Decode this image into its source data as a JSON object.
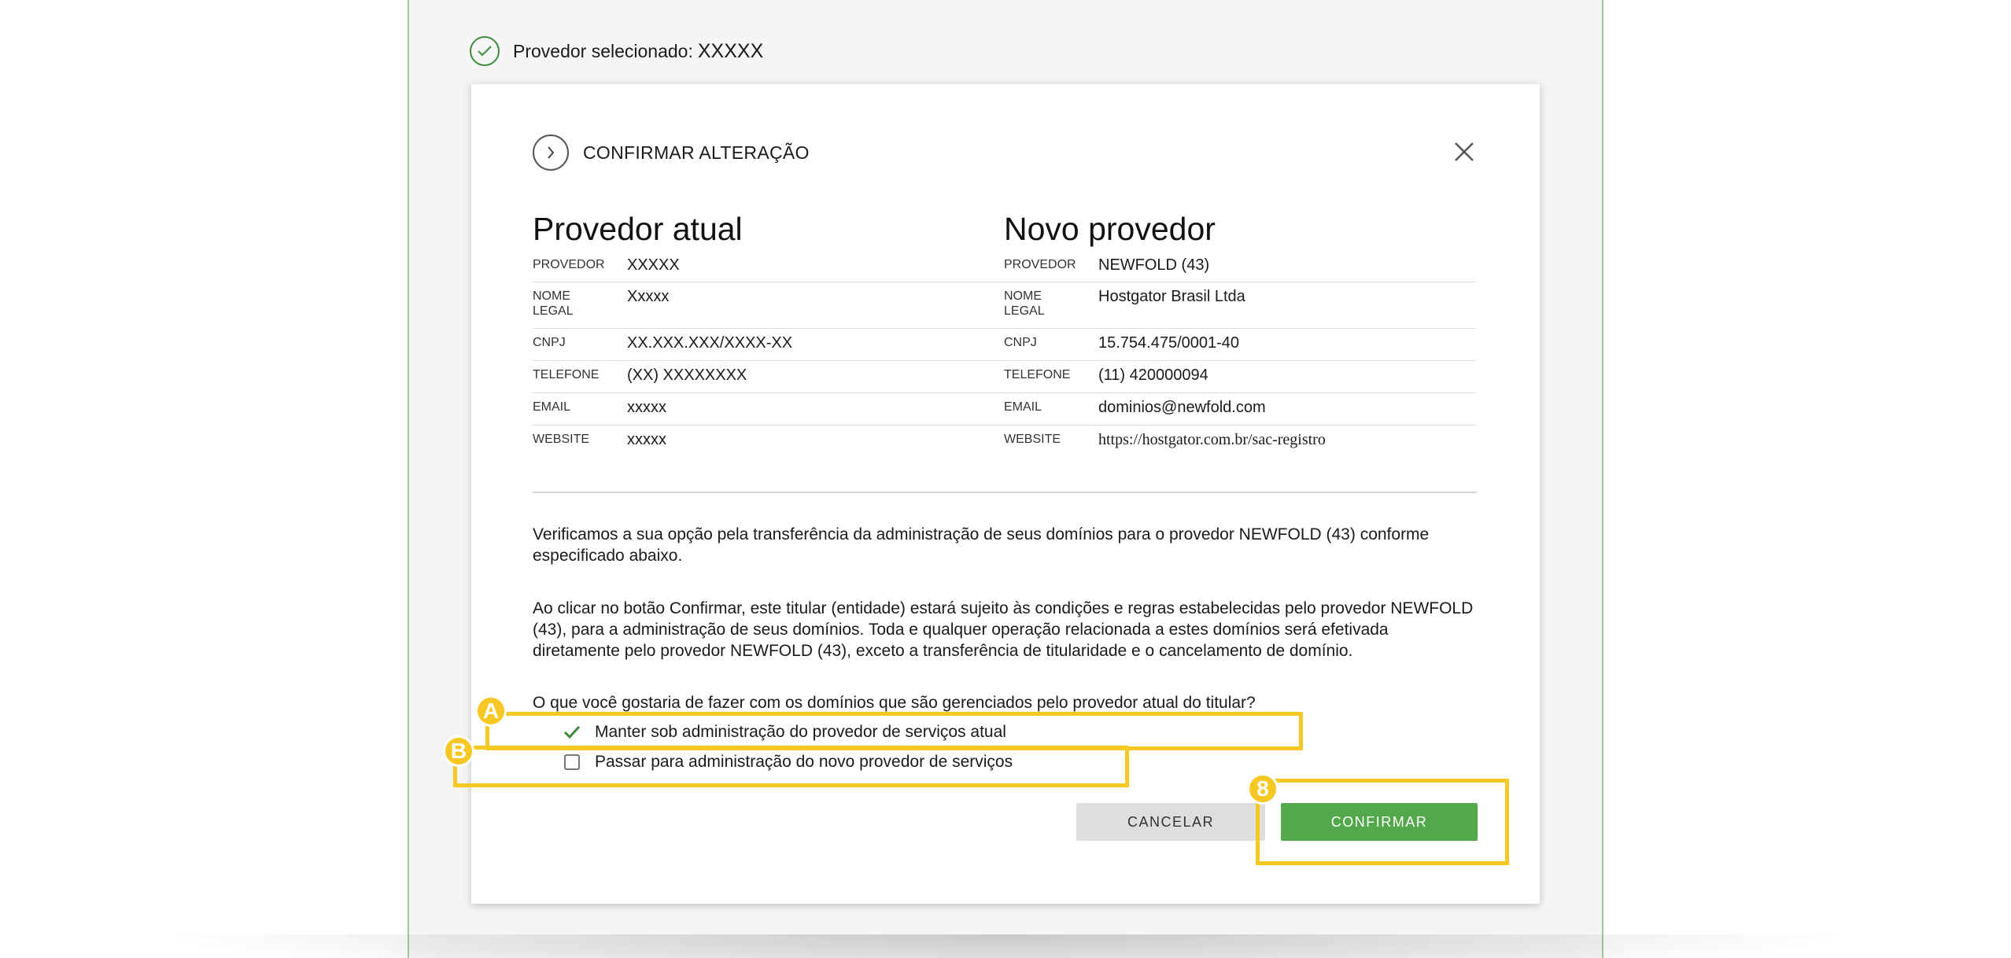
{
  "selected_provider": {
    "label": "Provedor selecionado:",
    "value": "XXXXX"
  },
  "modal": {
    "title": "CONFIRMAR ALTERAÇÃO",
    "current": {
      "heading": "Provedor atual",
      "rows": [
        {
          "label": "PROVEDOR",
          "value": "XXXXX"
        },
        {
          "label": "NOME\nLEGAL",
          "value": "Xxxxx"
        },
        {
          "label": "CNPJ",
          "value": "XX.XXX.XXX/XXXX-XX"
        },
        {
          "label": "TELEFONE",
          "value": "(XX) XXXXXXXX"
        },
        {
          "label": "EMAIL",
          "value": "xxxxx"
        },
        {
          "label": "WEBSITE",
          "value": "xxxxx"
        }
      ]
    },
    "new": {
      "heading": "Novo provedor",
      "rows": [
        {
          "label": "PROVEDOR",
          "value": "NEWFOLD (43)"
        },
        {
          "label": "NOME\nLEGAL",
          "value": "Hostgator Brasil Ltda"
        },
        {
          "label": "CNPJ",
          "value": "15.754.475/0001-40"
        },
        {
          "label": "TELEFONE",
          "value": "(11) 420000094"
        },
        {
          "label": "EMAIL",
          "value": "dominios@newfold.com"
        },
        {
          "label": "WEBSITE",
          "value": "https://hostgator.com.br/sac-registro"
        }
      ]
    },
    "paragraph1": "Verificamos a sua opção pela transferência da administração de seus domínios para o provedor NEWFOLD (43) conforme especificado abaixo.",
    "paragraph2": "Ao clicar no botão Confirmar, este titular (entidade) estará sujeito às condições e regras estabelecidas pelo provedor NEWFOLD (43), para a administração de seus domínios. Toda e qualquer operação relacionada a estes domínios será efetivada diretamente pelo provedor NEWFOLD (43), exceto a transferência de titularidade e o cancelamento de domínio.",
    "question": "O que você gostaria de fazer com os domínios que são gerenciados pelo provedor atual do titular?",
    "options": [
      {
        "label": "Manter sob administração do provedor de serviços atual",
        "checked": true
      },
      {
        "label": "Passar para administração do novo provedor de serviços",
        "checked": false
      }
    ],
    "cancel_label": "CANCELAR",
    "confirm_label": "CONFIRMAR"
  },
  "annotations": {
    "badge_a": "A",
    "badge_b": "B",
    "badge_8": "8",
    "highlight_color": "#f7c824"
  },
  "colors": {
    "accent_green": "#52a84a",
    "frame_border": "#9ccf95"
  }
}
